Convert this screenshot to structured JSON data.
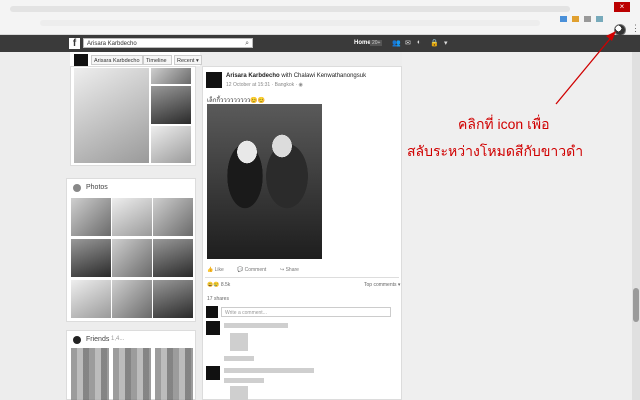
{
  "browser": {
    "close_label": "×",
    "menu_label": "⋮"
  },
  "fb": {
    "logo": "f",
    "search_value": "Arisara Karbdecho",
    "home_label": "Home",
    "home_count": "20+"
  },
  "profile": {
    "name_button": "Arisara Karbdecho",
    "timeline_label": "Timeline ▾",
    "recent_label": "Recent ▾"
  },
  "photos_title": "Photos",
  "friends": {
    "title": "Friends",
    "count": "1,4..."
  },
  "post": {
    "author": "Arisara Karbdecho",
    "with_text": "with Chalawi Kenwathanongsuk",
    "meta": "12 October at 15:31 · Bangkok · ◉",
    "text": "เล็กกี้ววววววววว😊😊",
    "like_label": "Like",
    "comment_label": "Comment",
    "share_label": "Share",
    "reactions": "8.5k",
    "top_comments": "Top comments ▾",
    "shares": "17 shares",
    "comment_placeholder": "Write a comment..."
  },
  "annotation": {
    "line1": "คลิกที่ icon เพื่อ",
    "line2": "สลับระหว่างโหมดสีกับขาวดำ",
    "color": "#d00000"
  }
}
